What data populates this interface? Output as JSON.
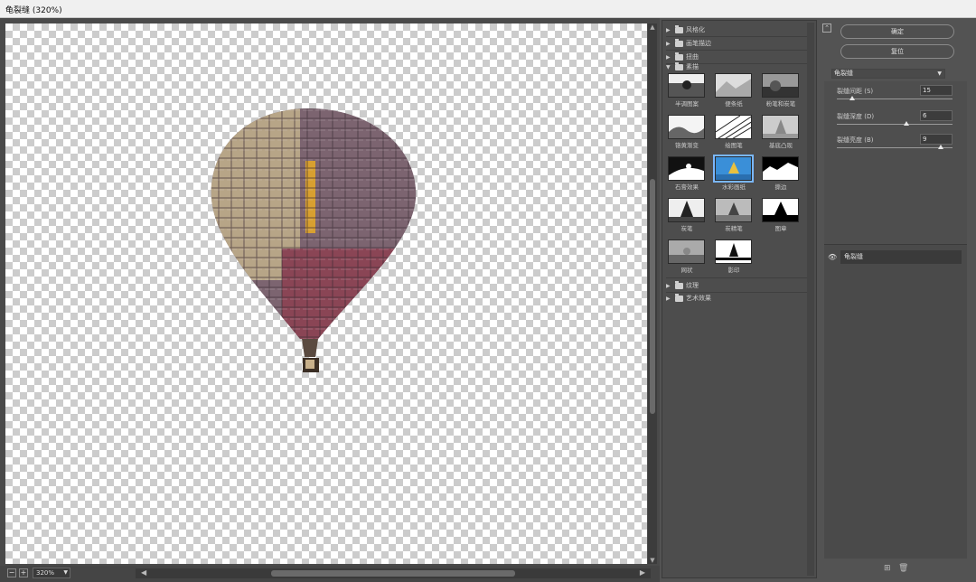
{
  "window": {
    "title": "龟裂缝 (320%)"
  },
  "statusbar": {
    "zoom_out": "−",
    "zoom_in": "+",
    "zoom_value": "320%",
    "left_arrow": "◀",
    "right_arrow": "▶"
  },
  "gallery": {
    "categories_top": [
      {
        "label": "风格化",
        "expanded": false
      },
      {
        "label": "画笔描边",
        "expanded": false
      },
      {
        "label": "扭曲",
        "expanded": false
      },
      {
        "label": "素描",
        "expanded": true
      }
    ],
    "thumbnails": [
      {
        "label": "半调图案"
      },
      {
        "label": "便条纸"
      },
      {
        "label": "粉笔和炭笔"
      },
      {
        "label": "铬黄渐变"
      },
      {
        "label": "绘图笔"
      },
      {
        "label": "基底凸现"
      },
      {
        "label": "石膏效果"
      },
      {
        "label": "水彩画纸"
      },
      {
        "label": "撕边"
      },
      {
        "label": "炭笔"
      },
      {
        "label": "炭精笔"
      },
      {
        "label": "图章"
      },
      {
        "label": "网状"
      },
      {
        "label": "影印"
      }
    ],
    "categories_bottom": [
      {
        "label": "纹理",
        "expanded": false
      },
      {
        "label": "艺术效果",
        "expanded": false
      }
    ]
  },
  "settings": {
    "ok_label": "确定",
    "reset_label": "复位",
    "selected_filter": "龟裂缝",
    "params": [
      {
        "label": "裂缝间距 (S)",
        "value": "15",
        "fraction": 0.13
      },
      {
        "label": "裂缝深度 (D)",
        "value": "6",
        "fraction": 0.6
      },
      {
        "label": "裂缝亮度 (B)",
        "value": "9",
        "fraction": 0.9
      }
    ],
    "layer_name": "龟裂缝"
  },
  "colors": {
    "panel": "#535353",
    "dark_panel": "#4d4d4d",
    "checker": "#cccccc"
  }
}
